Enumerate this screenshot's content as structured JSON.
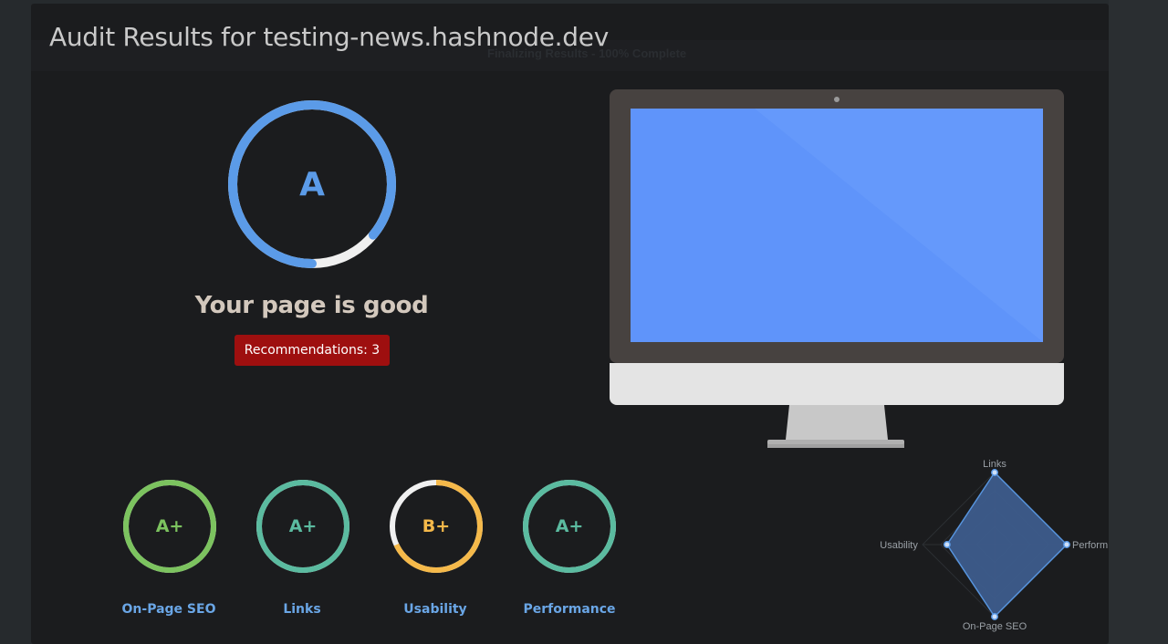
{
  "header": {
    "title": "Audit Results for testing-news.hashnode.dev",
    "progress_text": "Finalizing Results - 100% Complete"
  },
  "overall": {
    "grade": "A",
    "score_fraction": 0.86,
    "status_text": "Your page is good",
    "recommendations_label": "Recommendations: 3"
  },
  "categories": [
    {
      "key": "onpage",
      "grade": "A+",
      "label": "On-Page SEO",
      "color": "#7cc35f",
      "fraction": 1.0
    },
    {
      "key": "links",
      "grade": "A+",
      "label": "Links",
      "color": "#5bbba0",
      "fraction": 1.0
    },
    {
      "key": "usability",
      "grade": "B+",
      "label": "Usability",
      "color": "#f5b94a",
      "fraction": 0.68
    },
    {
      "key": "performance",
      "grade": "A+",
      "label": "Performance",
      "color": "#5bbba0",
      "fraction": 1.0
    }
  ],
  "radar": {
    "axes": [
      "Links",
      "Performance",
      "On-Page SEO",
      "Usability"
    ],
    "values": [
      1.0,
      1.0,
      1.0,
      0.66
    ]
  },
  "colors": {
    "accent": "#5b9be8",
    "ring_track": "#f0f0f0",
    "badge_red": "#9e0f0f",
    "screen_blue": "#5f94fa"
  }
}
